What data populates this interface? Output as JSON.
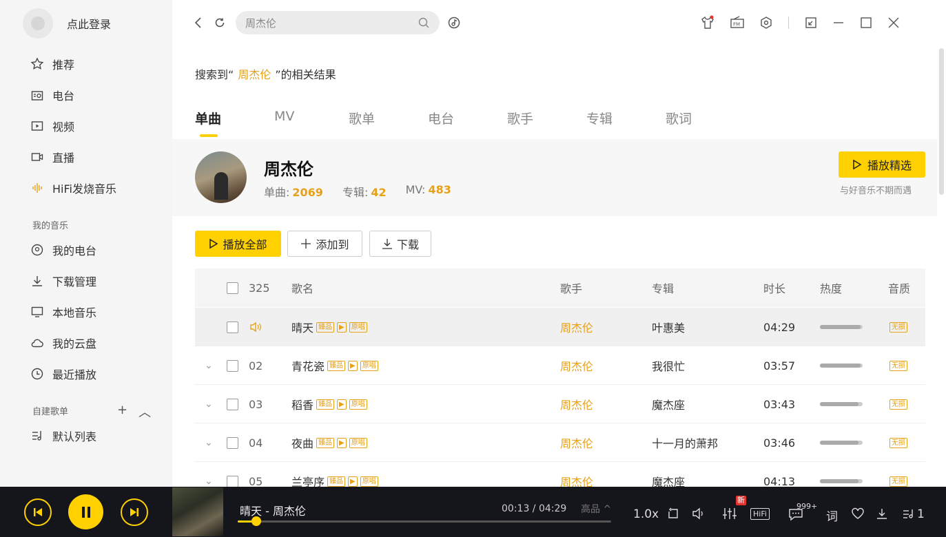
{
  "sidebar": {
    "login_text": "点此登录",
    "items": [
      {
        "label": "推荐",
        "icon": "star-icon"
      },
      {
        "label": "电台",
        "icon": "radio-icon"
      },
      {
        "label": "视频",
        "icon": "video-icon"
      },
      {
        "label": "直播",
        "icon": "live-icon"
      },
      {
        "label": "HiFi发烧音乐",
        "icon": "hifi-wave-icon"
      }
    ],
    "section_my_music": "我的音乐",
    "my_items": [
      {
        "label": "我的电台",
        "icon": "my-radio-icon"
      },
      {
        "label": "下载管理",
        "icon": "download-icon"
      },
      {
        "label": "本地音乐",
        "icon": "monitor-icon"
      },
      {
        "label": "我的云盘",
        "icon": "cloud-icon"
      },
      {
        "label": "最近播放",
        "icon": "clock-icon"
      }
    ],
    "section_playlists": "自建歌单",
    "playlists": [
      {
        "label": "默认列表",
        "icon": "list-icon"
      }
    ]
  },
  "search": {
    "value": "周杰伦"
  },
  "result": {
    "prefix": "搜索到",
    "open_quote": "“",
    "keyword": "周杰伦",
    "close_quote": "”",
    "suffix": "的相关结果"
  },
  "tabs": [
    "单曲",
    "MV",
    "歌单",
    "电台",
    "歌手",
    "专辑",
    "歌词"
  ],
  "artist": {
    "name": "周杰伦",
    "singles_label": "单曲:",
    "singles": "2069",
    "albums_label": "专辑:",
    "albums": "42",
    "mv_label": "MV:",
    "mv": "483",
    "play_button": "播放精选",
    "tagline": "与好音乐不期而遇"
  },
  "actions": {
    "play_all": "播放全部",
    "add_to": "添加到",
    "download": "下载"
  },
  "table": {
    "headers": {
      "count": "325",
      "name": "歌名",
      "singer": "歌手",
      "album": "专辑",
      "duration": "时长",
      "heat": "热度",
      "quality": "音质"
    },
    "tags": {
      "hq": "臻品",
      "mv": "▶",
      "original": "原唱"
    },
    "rows": [
      {
        "index": "",
        "title": "晴天",
        "singer": "周杰伦",
        "album": "叶惠美",
        "duration": "04:29",
        "heat": 0.95,
        "quality": "无损",
        "playing": true
      },
      {
        "index": "02",
        "title": "青花瓷",
        "singer": "周杰伦",
        "album": "我很忙",
        "duration": "03:57",
        "heat": 0.95,
        "quality": "无损"
      },
      {
        "index": "03",
        "title": "稻香",
        "singer": "周杰伦",
        "album": "魔杰座",
        "duration": "03:43",
        "heat": 0.9,
        "quality": "无损"
      },
      {
        "index": "04",
        "title": "夜曲",
        "singer": "周杰伦",
        "album": "十一月的萧邦",
        "duration": "03:46",
        "heat": 0.9,
        "quality": "无损"
      },
      {
        "index": "05",
        "title": "兰亭序",
        "singer": "周杰伦",
        "album": "魔杰座",
        "duration": "04:13",
        "heat": 0.9,
        "quality": "无损"
      }
    ]
  },
  "player": {
    "title": "晴天 - 周杰伦",
    "time": "00:13 / 04:29",
    "quality": "高品 ^",
    "progress": 0.05,
    "speed": "1.0x",
    "hifi": "HiFi",
    "new_badge": "新",
    "comments": "999+",
    "lyrics": "词",
    "queue_count": "1"
  }
}
